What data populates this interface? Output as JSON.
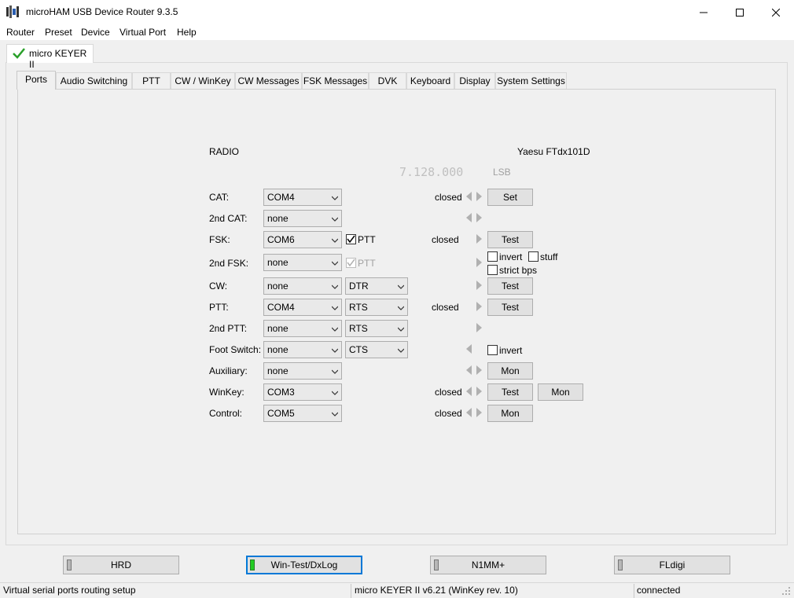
{
  "window": {
    "title": "microHAM USB Device Router 9.3.5"
  },
  "menu": [
    "Router",
    "Preset",
    "Device",
    "Virtual Port",
    "Help"
  ],
  "device_tab": {
    "label": "micro KEYER II",
    "status_icon": "check-icon",
    "status_color": "#2aa02a"
  },
  "tabs": [
    "Ports",
    "Audio Switching",
    "PTT",
    "CW / WinKey",
    "CW Messages",
    "FSK Messages",
    "DVK",
    "Keyboard",
    "Display",
    "System Settings"
  ],
  "active_tab": "Ports",
  "radio": {
    "section_label": "RADIO",
    "model": "Yaesu FTdx101D",
    "frequency": "7.128.000",
    "mode": "LSB"
  },
  "ports": {
    "cat": {
      "label": "CAT:",
      "value": "COM4",
      "status": "closed",
      "button": "Set"
    },
    "cat2": {
      "label": "2nd CAT:",
      "value": "none"
    },
    "fsk": {
      "label": "FSK:",
      "value": "COM6",
      "ptt_label": "PTT",
      "ptt_checked": true,
      "status": "closed",
      "button": "Test"
    },
    "fsk2": {
      "label": "2nd FSK:",
      "value": "none",
      "ptt_label": "PTT",
      "ptt_checked": true,
      "ptt_disabled": true,
      "invert_label": "invert",
      "stuff_label": "stuff",
      "strict_label": "strict bps"
    },
    "cw": {
      "label": "CW:",
      "value": "none",
      "line": "DTR",
      "button": "Test"
    },
    "ptt": {
      "label": "PTT:",
      "value": "COM4",
      "line": "RTS",
      "status": "closed",
      "button": "Test"
    },
    "ptt2": {
      "label": "2nd PTT:",
      "value": "none",
      "line": "RTS"
    },
    "footswitch": {
      "label": "Foot Switch:",
      "value": "none",
      "line": "CTS",
      "invert_label": "invert"
    },
    "aux": {
      "label": "Auxiliary:",
      "value": "none",
      "button": "Mon"
    },
    "winkey": {
      "label": "WinKey:",
      "value": "COM3",
      "status": "closed",
      "button": "Test",
      "button2": "Mon"
    },
    "control": {
      "label": "Control:",
      "value": "COM5",
      "status": "closed",
      "button": "Mon"
    }
  },
  "app_buttons": [
    {
      "label": "HRD",
      "active": false
    },
    {
      "label": "Win-Test/DxLog",
      "active": true
    },
    {
      "label": "N1MM+",
      "active": false
    },
    {
      "label": "FLdigi",
      "active": false
    }
  ],
  "statusbar": {
    "left": "Virtual serial ports routing setup",
    "middle": "micro KEYER II v6.21 (WinKey rev. 10)",
    "right": "connected"
  }
}
